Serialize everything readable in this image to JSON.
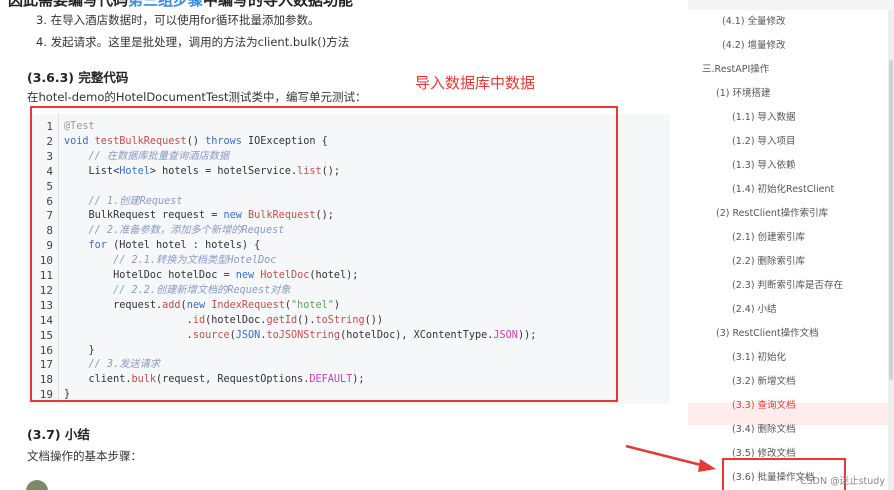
{
  "article": {
    "top_clip_pre": "因此需要编写代码",
    "top_clip_link": "第三组步骤",
    "top_clip_post": "中编写的导入数据功能",
    "step3": "3. 在导入酒店数据时，可以使用for循环批量添加参数。",
    "step4": "4. 发起请求。这里是批处理，调用的方法为client.bulk()方法",
    "section_363": "(3.6.3) 完整代码",
    "intro": "在hotel-demo的HotelDocumentTest测试类中，编写单元测试：",
    "annotation": "导入数据库中数据",
    "section_37": "(3.7) 小结",
    "summary": "文档操作的基本步骤："
  },
  "code": {
    "line_numbers": [
      "1",
      "2",
      "3",
      "4",
      "5",
      "6",
      "7",
      "8",
      "9",
      "10",
      "11",
      "12",
      "13",
      "14",
      "15",
      "16",
      "17",
      "18",
      "19"
    ],
    "lines": [
      [
        [
          "an",
          "@Test"
        ]
      ],
      [
        [
          "kw",
          "void "
        ],
        [
          "fn",
          "testBulkRequest"
        ],
        [
          "tp",
          "() "
        ],
        [
          "kw",
          "throws "
        ],
        [
          "tp",
          "IOException {"
        ]
      ],
      [
        [
          "cm",
          "    // 在数据库批量查询酒店数据"
        ]
      ],
      [
        [
          "tp",
          "    List<"
        ],
        [
          "kw",
          "Hotel"
        ],
        [
          "tp",
          "> hotels = hotelService."
        ],
        [
          "fn",
          "list"
        ],
        [
          "tp",
          "();"
        ]
      ],
      [
        [
          "tp",
          ""
        ]
      ],
      [
        [
          "cm",
          "    // 1.创建Request"
        ]
      ],
      [
        [
          "tp",
          "    BulkRequest request = "
        ],
        [
          "kw",
          "new "
        ],
        [
          "fn",
          "BulkRequest"
        ],
        [
          "tp",
          "();"
        ]
      ],
      [
        [
          "cm",
          "    // 2.准备参数，添加多个新增的Request"
        ]
      ],
      [
        [
          "kw",
          "    for "
        ],
        [
          "tp",
          "(Hotel hotel : hotels) {"
        ]
      ],
      [
        [
          "cm",
          "        // 2.1.转换为文档类型HotelDoc"
        ]
      ],
      [
        [
          "tp",
          "        HotelDoc hotelDoc = "
        ],
        [
          "kw",
          "new "
        ],
        [
          "fn",
          "HotelDoc"
        ],
        [
          "tp",
          "(hotel);"
        ]
      ],
      [
        [
          "cm",
          "        // 2.2.创建新增文档的Request对象"
        ]
      ],
      [
        [
          "tp",
          "        request."
        ],
        [
          "fn",
          "add"
        ],
        [
          "tp",
          "("
        ],
        [
          "kw",
          "new "
        ],
        [
          "fn",
          "IndexRequest"
        ],
        [
          "tp",
          "("
        ],
        [
          "st",
          "\"hotel\""
        ],
        [
          "tp",
          ")"
        ]
      ],
      [
        [
          "tp",
          "                    ."
        ],
        [
          "fn",
          "id"
        ],
        [
          "tp",
          "(hotelDoc."
        ],
        [
          "fn",
          "getId"
        ],
        [
          "tp",
          "()."
        ],
        [
          "fn",
          "toString"
        ],
        [
          "tp",
          "())"
        ]
      ],
      [
        [
          "tp",
          "                    ."
        ],
        [
          "fn",
          "source"
        ],
        [
          "tp",
          "("
        ],
        [
          "kw",
          "JSON"
        ],
        [
          "tp",
          "."
        ],
        [
          "fn",
          "toJSONString"
        ],
        [
          "tp",
          "(hotelDoc), XContentType."
        ],
        [
          "cs",
          "JSON"
        ],
        [
          "tp",
          "));"
        ]
      ],
      [
        [
          "tp",
          "    }"
        ]
      ],
      [
        [
          "cm",
          "    // 3.发送请求"
        ]
      ],
      [
        [
          "tp",
          "    client."
        ],
        [
          "fn",
          "bulk"
        ],
        [
          "tp",
          "(request, RequestOptions."
        ],
        [
          "cs",
          "DEFAULT"
        ],
        [
          "tp",
          ");"
        ]
      ],
      [
        [
          "tp",
          "}"
        ]
      ]
    ]
  },
  "toc": [
    {
      "label": "(4.1) 全量修改",
      "active": false
    },
    {
      "label": "(4.2) 增量修改",
      "active": false
    },
    {
      "label": "三.RestAPI操作",
      "active": false
    },
    {
      "label": "(1) 环境搭建",
      "active": false
    },
    {
      "label": "(1.1) 导入数据",
      "active": false
    },
    {
      "label": "(1.2) 导入项目",
      "active": false
    },
    {
      "label": "(1.3) 导入依赖",
      "active": false
    },
    {
      "label": "(1.4) 初始化RestClient",
      "active": false
    },
    {
      "label": "(2) RestClient操作索引库",
      "active": false
    },
    {
      "label": "(2.1) 创建索引库",
      "active": false
    },
    {
      "label": "(2.2) 删除索引库",
      "active": false
    },
    {
      "label": "(2.3) 判断索引库是否存在",
      "active": false
    },
    {
      "label": "(2.4) 小结",
      "active": false
    },
    {
      "label": "(3) RestClient操作文档",
      "active": false
    },
    {
      "label": "(3.1) 初始化",
      "active": false
    },
    {
      "label": "(3.2) 新增文档",
      "active": false
    },
    {
      "label": "(3.3) 查询文档",
      "active": true
    },
    {
      "label": "(3.4) 删除文档",
      "active": false
    },
    {
      "label": "(3.5) 修改文档",
      "active": false
    },
    {
      "label": "(3.6) 批量操作文档",
      "active": false
    }
  ],
  "watermark": "CSDN @迷止study",
  "colors": {
    "annotation_red": "#e53935",
    "active_toc": "#e53935"
  }
}
